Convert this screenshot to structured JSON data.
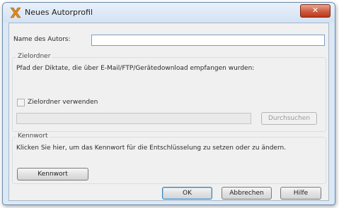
{
  "window": {
    "title": "Neues Autorprofil",
    "close_glyph": "✕",
    "icon": "dictation-x-icon"
  },
  "author": {
    "label": "Name des Autors:",
    "value": ""
  },
  "target_folder": {
    "legend": "Zielordner",
    "description": "Pfad der Diktate, die über E-Mail/FTP/Gerätedownload empfangen wurden:",
    "checkbox_label": "Zielordner verwenden",
    "checkbox_checked": false,
    "path_value": "",
    "browse_label": "Durchsuchen"
  },
  "password": {
    "legend": "Kennwort",
    "description": "Klicken Sie hier, um das Kennwort für die Entschlüsselung zu setzen oder zu ändern.",
    "button_label": "Kennwort"
  },
  "footer": {
    "ok_label": "OK",
    "cancel_label": "Abbrechen",
    "help_label": "Hilfe"
  }
}
